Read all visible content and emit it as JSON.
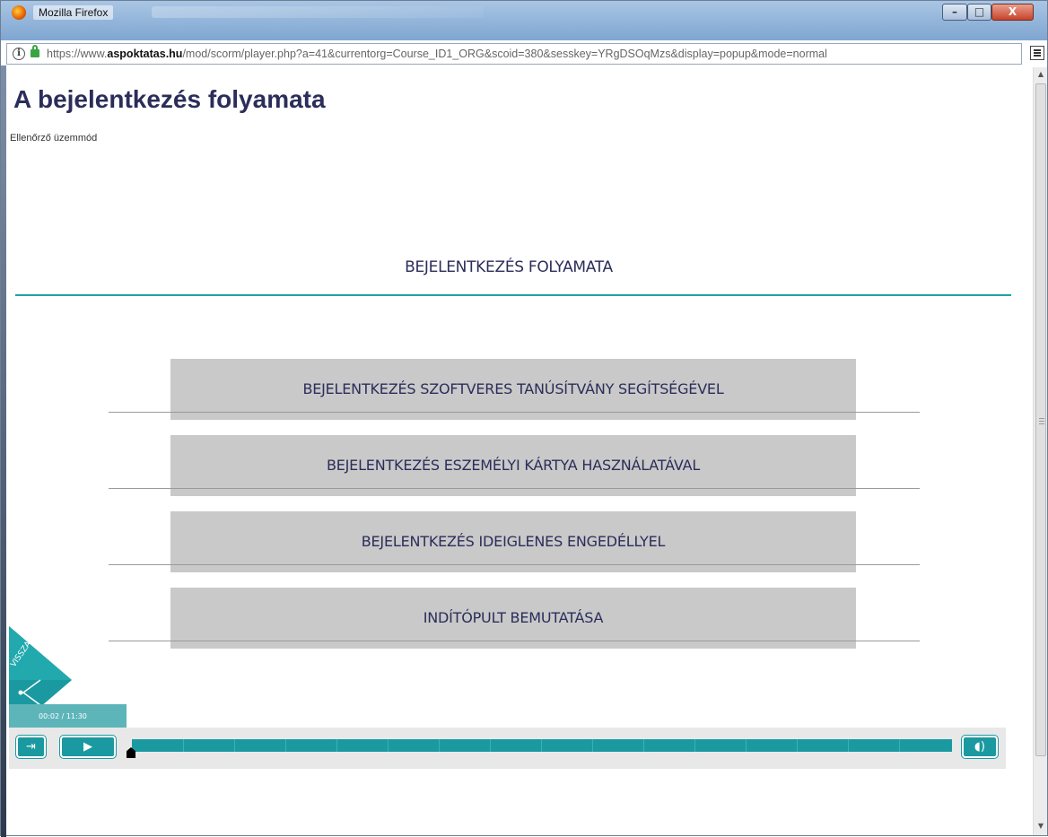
{
  "window": {
    "title": "Mozilla Firefox",
    "buttons": {
      "minimize": "–",
      "maximize": "□",
      "close": "X"
    }
  },
  "urlbar": {
    "prefix": "https://www.",
    "domain": "aspoktatas.hu",
    "path": "/mod/scorm/player.php?a=41&currentorg=Course_ID1_ORG&scoid=380&sesskey=YRgDSOqMzs&display=popup&mode=normal",
    "info_glyph": "i"
  },
  "page": {
    "title": "A bejelentkezés folyamata",
    "mode": "Ellenőrző üzemmód"
  },
  "course": {
    "section_title": "BEJELENTKEZÉS FOLYAMATA",
    "menu": [
      {
        "label": "BEJELENTKEZÉS SZOFTVERES TANÚSÍTVÁNY SEGÍTSÉGÉVEL"
      },
      {
        "label": "BEJELENTKEZÉS ESZEMÉLYI KÁRTYA HASZNÁLATÁVAL"
      },
      {
        "label": "BEJELENTKEZÉS IDEIGLENES ENGEDÉLLYEL"
      },
      {
        "label": "INDÍTÓPULT BEMUTATÁSA"
      }
    ],
    "back_label": "VISSZA"
  },
  "player": {
    "time": "00:02 / 11:30",
    "progress_fraction": 0.003,
    "exit_icon": "exit-icon",
    "play_icon": "play-icon",
    "volume_icon": "volume-icon",
    "accent": "#1a9aa0"
  },
  "colors": {
    "title": "#2b2d5a",
    "teal": "#1ba3a8",
    "menu_bg": "#c9c9c9"
  }
}
